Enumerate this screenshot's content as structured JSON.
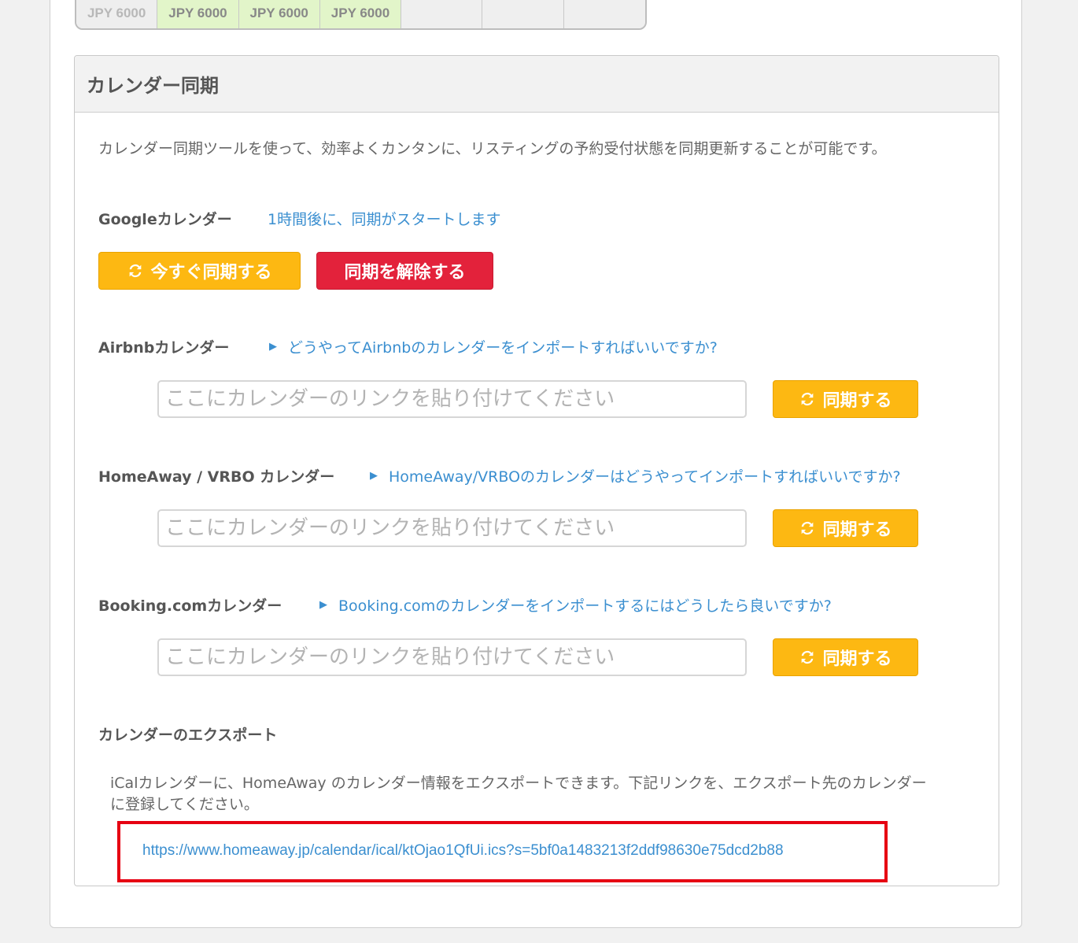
{
  "price_strip": {
    "cells": [
      {
        "text": "JPY 6000",
        "state": "muted"
      },
      {
        "text": "JPY 6000",
        "state": "avail"
      },
      {
        "text": "JPY 6000",
        "state": "avail"
      },
      {
        "text": "JPY 6000",
        "state": "avail"
      },
      {
        "text": "",
        "state": "empty"
      },
      {
        "text": "",
        "state": "empty"
      },
      {
        "text": "",
        "state": "empty"
      }
    ]
  },
  "panel": {
    "title": "カレンダー同期",
    "intro": "カレンダー同期ツールを使って、効率よくカンタンに、リスティングの予約受付状態を同期更新することが可能です。"
  },
  "google": {
    "label": "Googleカレンダー",
    "status": "1時間後に、同期がスタートします",
    "sync_now_label": "今すぐ同期する",
    "unsync_label": "同期を解除する"
  },
  "airbnb": {
    "label": "Airbnbカレンダー",
    "help": "どうやってAirbnbのカレンダーをインポートすればいいですか?",
    "placeholder": "ここにカレンダーのリンクを貼り付けてください",
    "sync_label": "同期する"
  },
  "homeaway": {
    "label": "HomeAway / VRBO カレンダー",
    "help": "HomeAway/VRBOのカレンダーはどうやってインポートすればいいですか?",
    "placeholder": "ここにカレンダーのリンクを貼り付けてください",
    "sync_label": "同期する"
  },
  "booking": {
    "label": "Booking.comカレンダー",
    "help": "Booking.comのカレンダーをインポートするにはどうしたら良いですか?",
    "placeholder": "ここにカレンダーのリンクを貼り付けてください",
    "sync_label": "同期する"
  },
  "export": {
    "label": "カレンダーのエクスポート",
    "text": "iCalカレンダーに、HomeAway のカレンダー情報をエクスポートできます。下記リンクを、エクスポート先のカレンダーに登録してください。",
    "link": "https://www.homeaway.jp/calendar/ical/ktOjao1QfUi.ics?s=5bf0a1483213f2ddf98630e75dcd2b88"
  },
  "colors": {
    "accent_yellow": "#fdb812",
    "danger_red": "#e3223b",
    "link_blue": "#3b8fd0",
    "highlight_red": "#e60012"
  },
  "icons": {
    "sync": "sync-icon",
    "help_arrow": "triangle-right-icon"
  }
}
